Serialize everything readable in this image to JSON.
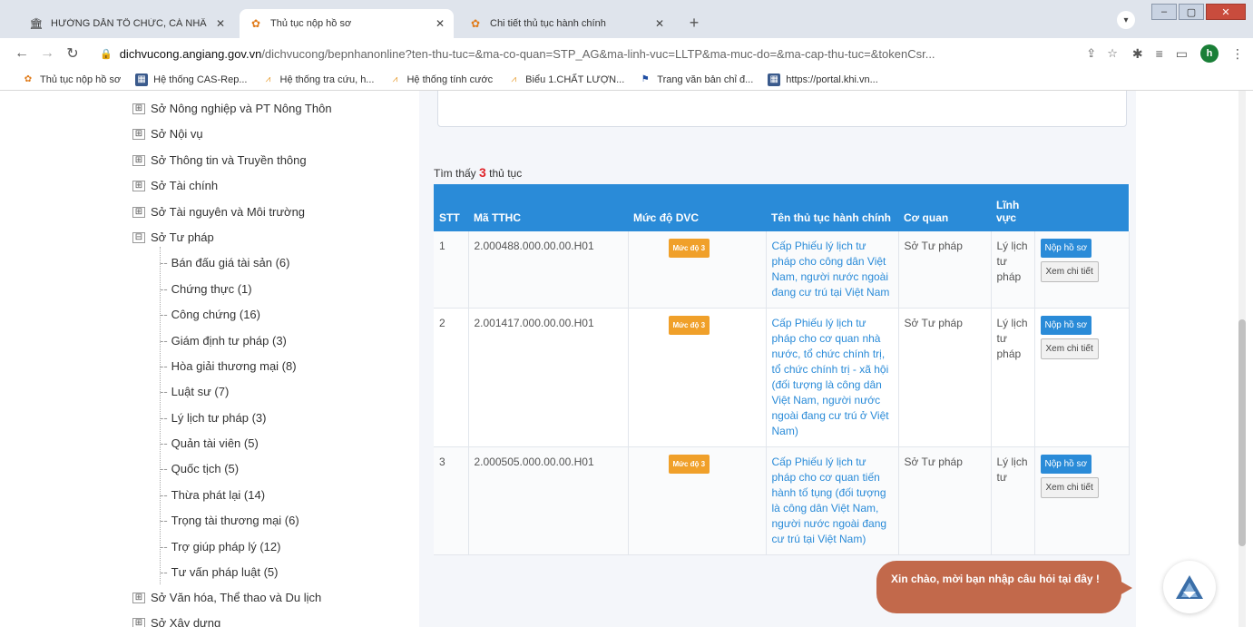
{
  "tabs": [
    {
      "title": "HƯỚNG DẪN TỔ CHỨC, CÁ NHÂ",
      "icon": "page-icon"
    },
    {
      "title": "Thủ tục nộp hồ sơ",
      "icon": "lotus-icon"
    },
    {
      "title": "Chi tiết thủ tục hành chính",
      "icon": "lotus-icon"
    }
  ],
  "address": {
    "domain": "dichvucong.angiang.gov.vn",
    "path": "/dichvucong/bepnhanonline?ten-thu-tuc=&ma-co-quan=STP_AG&ma-linh-vuc=LLTP&ma-muc-do=&ma-cap-thu-tuc=&tokenCsr..."
  },
  "profile_initial": "h",
  "bookmarks": [
    "Thủ tục nộp hồ sơ",
    "Hệ thống CAS-Rep...",
    "Hệ thống tra cứu, h...",
    "Hệ thống tính cước",
    "Biểu 1.CHẤT LƯỢN...",
    "Trang văn bản chỉ đ...",
    "https://portal.khi.vn..."
  ],
  "tree": {
    "top_nodes": [
      "Sở Nông nghiệp và PT Nông Thôn",
      "Sở Nội vụ",
      "Sở Thông tin và Truyền thông",
      "Sở Tài chính",
      "Sở Tài nguyên và Môi trường",
      "Sở Tư pháp"
    ],
    "children": [
      "Bán đấu giá tài sản (6)",
      "Chứng thực (1)",
      "Công chứng (16)",
      "Giám định tư pháp (3)",
      "Hòa giải thương mại (8)",
      "Luật sư (7)",
      "Lý lịch tư pháp (3)",
      "Quản tài viên (5)",
      "Quốc tịch (5)",
      "Thừa phát lại (14)",
      "Trọng tài thương mại (6)",
      "Trợ giúp pháp lý (12)",
      "Tư vấn pháp luật (5)"
    ],
    "bottom_nodes": [
      "Sở Văn hóa, Thể thao và Du lịch",
      "Sở Xây dựng"
    ]
  },
  "found": {
    "prefix": "Tìm thấy",
    "count": "3",
    "suffix": "thủ tục"
  },
  "table": {
    "headers": [
      "STT",
      "Mã TTHC",
      "Mức độ DVC",
      "Tên thủ tục hành chính",
      "Cơ quan",
      "Lĩnh vực",
      ""
    ],
    "rows": [
      {
        "stt": "1",
        "code": "2.000488.000.00.00.H01",
        "level": "Mức độ 3",
        "name": "Cấp Phiếu lý lịch tư pháp cho công dân Việt Nam, người nước ngoài đang cư trú tại Việt Nam",
        "agency": "Sở Tư pháp",
        "field": "Lý lịch tư pháp"
      },
      {
        "stt": "2",
        "code": "2.001417.000.00.00.H01",
        "level": "Mức độ 3",
        "name": "Cấp Phiếu lý lịch tư pháp cho cơ quan nhà nước, tổ chức chính trị, tổ chức chính trị - xã hội (đối tượng là công dân Việt Nam, người nước ngoài đang cư trú ở Việt Nam)",
        "agency": "Sở Tư pháp",
        "field": "Lý lịch tư pháp"
      },
      {
        "stt": "3",
        "code": "2.000505.000.00.00.H01",
        "level": "Mức độ 3",
        "name": "Cấp Phiếu lý lịch tư pháp cho cơ quan tiến hành tố tụng (đối tượng là công dân Việt Nam, người nước ngoài đang cư trú tại Việt Nam)",
        "agency": "Sở Tư pháp",
        "field": "Lý lịch tư"
      }
    ],
    "submit_label": "Nộp hồ sơ",
    "detail_label": "Xem chi tiết"
  },
  "chat": {
    "message": "Xin chào, mời bạn nhập câu hỏi tại đây !"
  },
  "colors": {
    "header_blue": "#2a8bd8",
    "badge_orange": "#f0a02a",
    "chat_bubble": "#c2694b",
    "count_red": "#e0242a"
  }
}
